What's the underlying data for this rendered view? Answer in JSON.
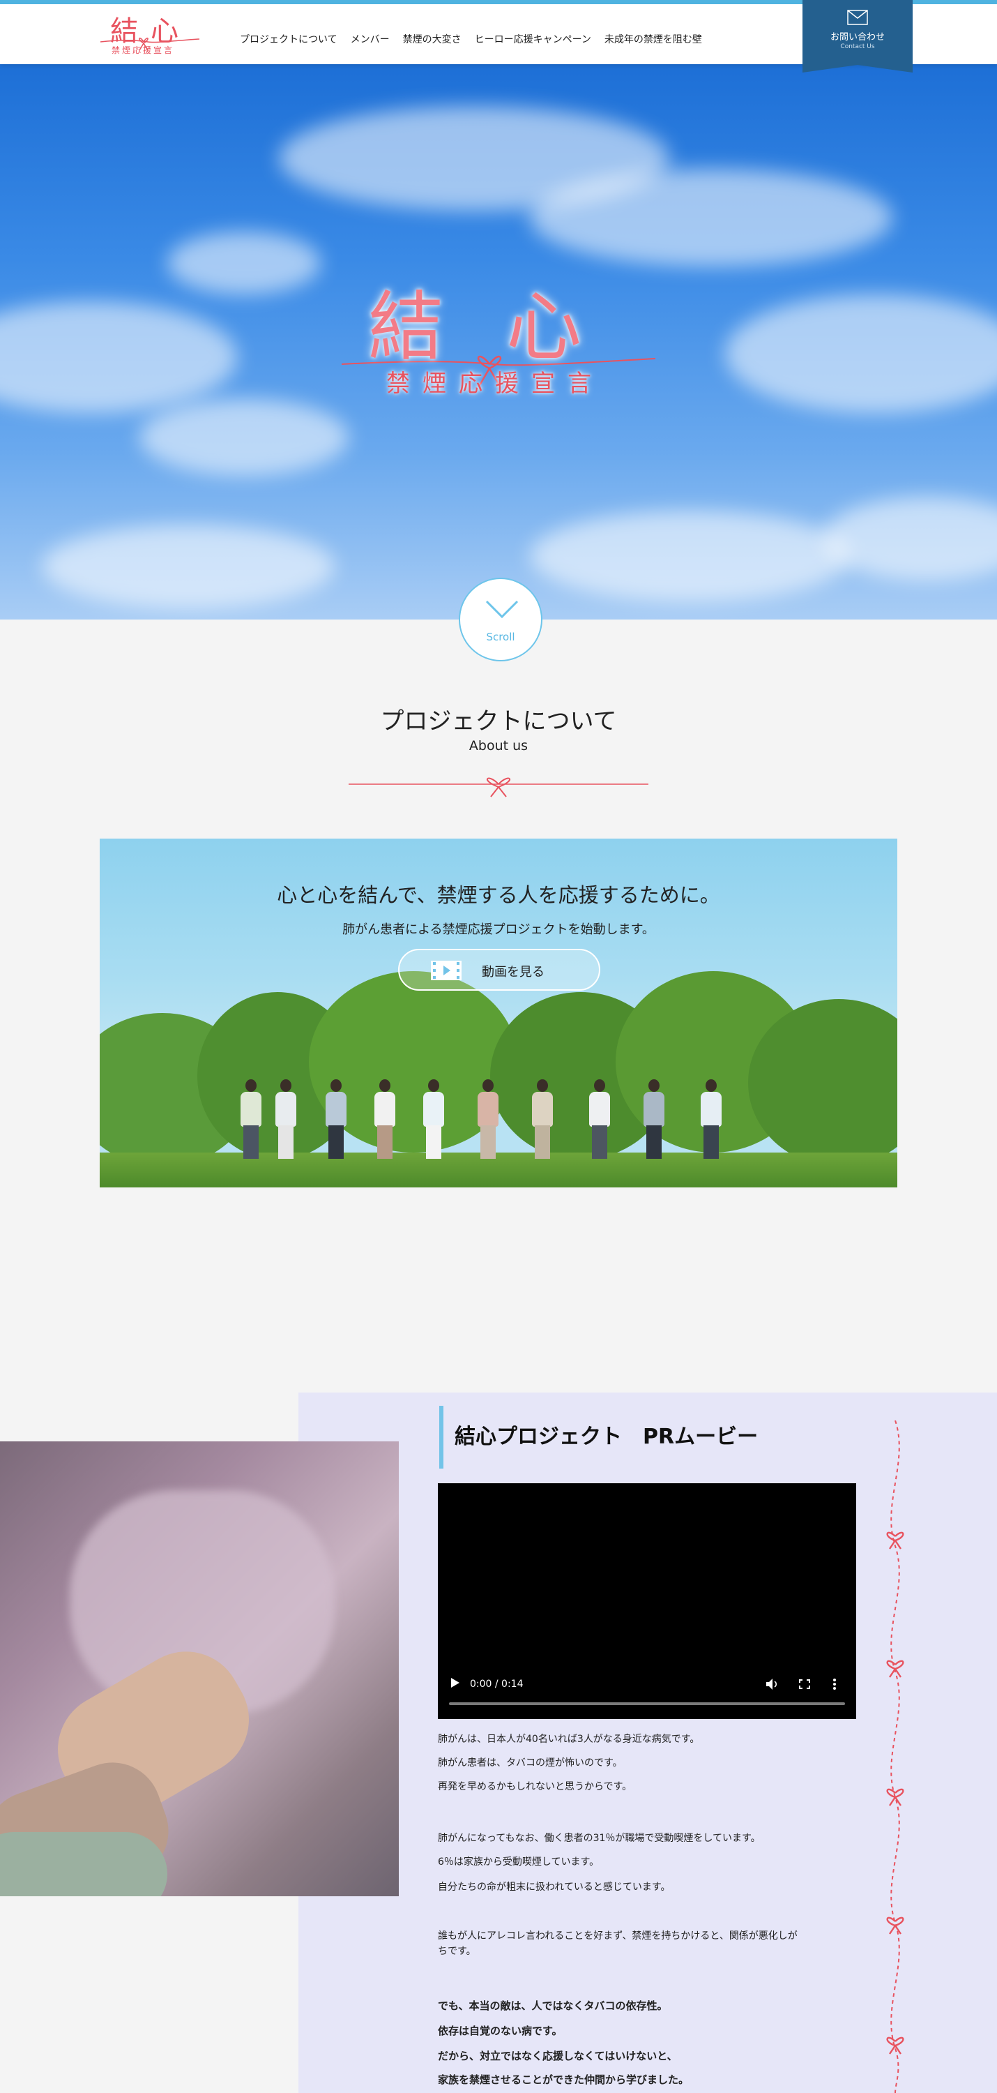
{
  "header": {
    "logo_title": "結心",
    "logo_sub": "禁煙応援宣言",
    "nav": [
      {
        "label": "プロジェクトについて"
      },
      {
        "label": "メンバー"
      },
      {
        "label": "禁煙の大変さ"
      },
      {
        "label": "ヒーロー応援キャンペーン"
      },
      {
        "label": "未成年の禁煙を阻む壁"
      }
    ],
    "contact_main": "お問い合わせ",
    "contact_sub": "Contact Us"
  },
  "hero": {
    "title": "結心",
    "subtitle": "禁煙応援宣言",
    "scroll_label": "Scroll"
  },
  "about": {
    "title": "プロジェクトについて",
    "subtitle": "About us",
    "banner_heading": "心と心を結んで、禁煙する人を応援するために。",
    "banner_text": "肺がん患者による禁煙応援プロジェクトを始動します。",
    "video_button": "動画を見る"
  },
  "pr": {
    "title": "結心プロジェクト　PRムービー",
    "video_time": "0:00 / 0:14",
    "paragraphs": [
      "肺がんは、日本人が40名いれば3人がなる身近な病気です。",
      "肺がん患者は、タバコの煙が怖いのです。",
      "再発を早めるかもしれないと思うからです。",
      "肺がんになってもなお、働く患者の31％が職場で受動喫煙をしています。",
      "6％は家族から受動喫煙しています。",
      "自分たちの命が粗末に扱われていると感じています。",
      "誰もが人にアレコレ言われることを好まず、禁煙を持ちかけると、関係が悪化しがちです。",
      "でも、本当の敵は、人ではなくタバコの依存性。",
      "依存は自覚のない病です。",
      "だから、対立ではなく応援しなくてはいけないと、",
      "家族を禁煙させることができた仲間から学びました。"
    ]
  },
  "colors": {
    "accent_red": "#e8535f",
    "accent_blue": "#24608f",
    "light_blue": "#72c3e8",
    "pr_background": "#e6e6f8"
  }
}
